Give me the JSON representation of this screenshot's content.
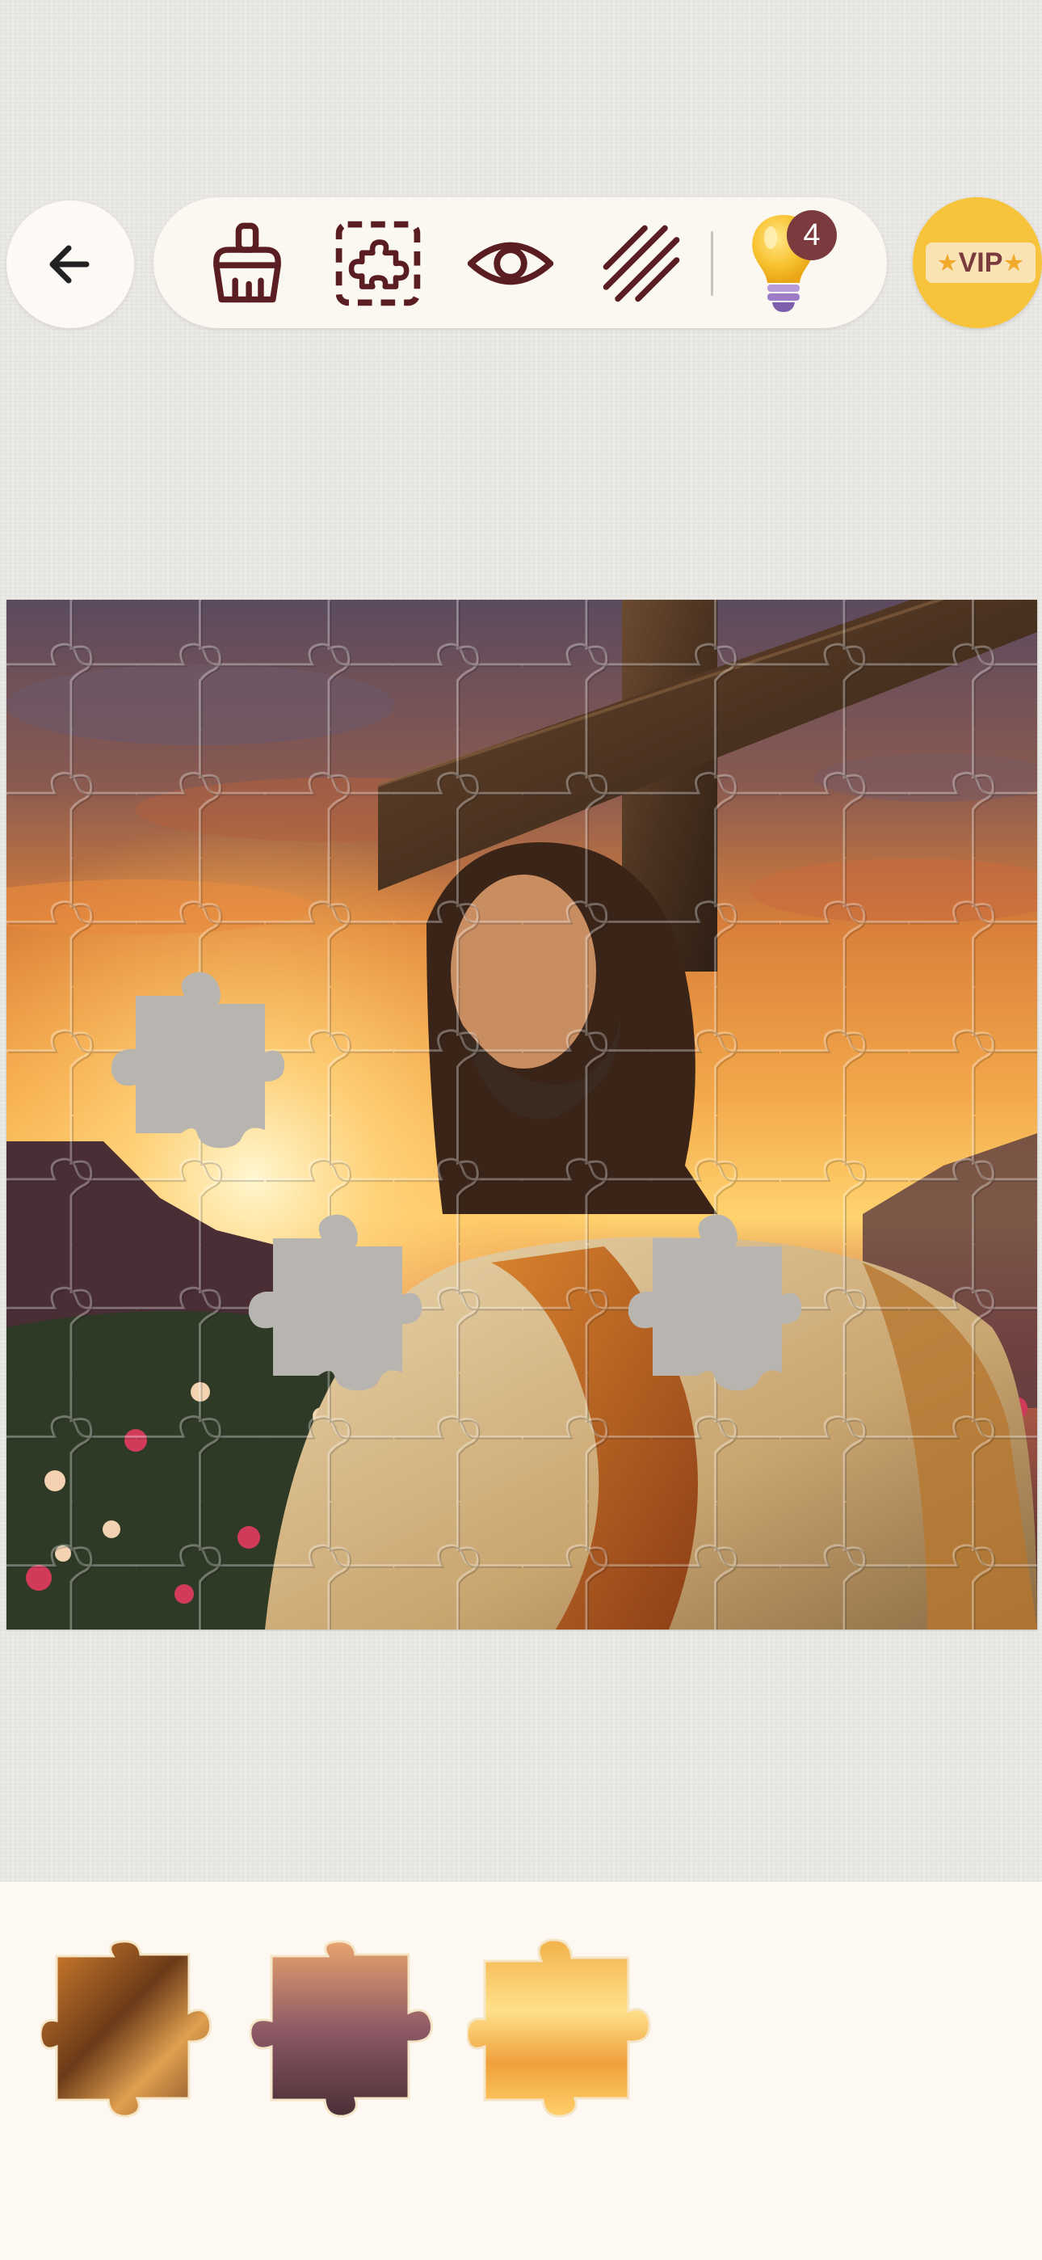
{
  "toolbar": {
    "back": "back-arrow-icon",
    "tools": [
      "broom-icon",
      "puzzle-frame-icon",
      "eye-icon",
      "stripes-icon"
    ],
    "hint": {
      "icon": "lightbulb-icon",
      "count": "4"
    }
  },
  "vip": {
    "label": "VIP"
  },
  "puzzle": {
    "grid": {
      "cols": 8,
      "rows": 8
    },
    "missing_pieces": 3
  },
  "tray": {
    "pieces": [
      "tray-piece-wood",
      "tray-piece-mountain",
      "tray-piece-sunset"
    ]
  },
  "colors": {
    "accent": "#7a3a3e",
    "vip": "#f6c33a",
    "tray": "#fdf8f2",
    "background": "#eceae6"
  }
}
